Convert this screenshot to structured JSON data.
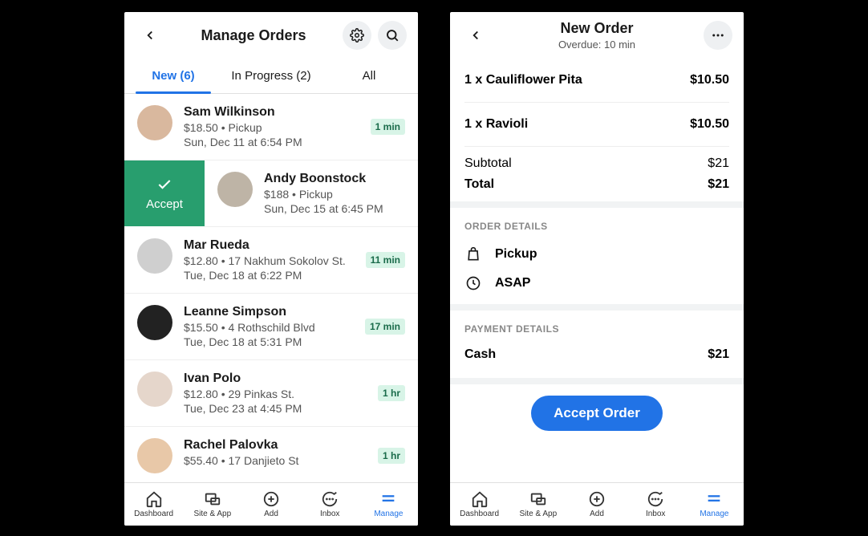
{
  "left": {
    "title": "Manage Orders",
    "tabs": [
      {
        "label": "New (6)",
        "active": true
      },
      {
        "label": "In Progress (2)",
        "active": false
      },
      {
        "label": "All",
        "active": false
      }
    ],
    "accept_label": "Accept",
    "orders": [
      {
        "name": "Sam Wilkinson",
        "meta": "$18.50  •  Pickup",
        "date": "Sun, Dec 11 at 6:54 PM",
        "badge": "1 min",
        "shifted": false,
        "avatar": "#d9b89e"
      },
      {
        "name": "Andy Boonstock",
        "meta": "$188  •  Pickup",
        "date": "Sun, Dec 15 at 6:45 PM",
        "badge": "",
        "shifted": true,
        "avatar": "#beb4a6"
      },
      {
        "name": "Mar Rueda",
        "meta": "$12.80  •  17 Nakhum Sokolov St.",
        "date": "Tue, Dec 18 at 6:22 PM",
        "badge": "11 min",
        "shifted": false,
        "avatar": "#cfcfcf"
      },
      {
        "name": "Leanne Simpson",
        "meta": "$15.50  •  4 Rothschild Blvd",
        "date": "Tue, Dec 18 at 5:31 PM",
        "badge": "17 min",
        "shifted": false,
        "avatar": "#222"
      },
      {
        "name": "Ivan Polo",
        "meta": "$12.80  •  29 Pinkas St.",
        "date": "Tue, Dec 23 at 4:45 PM",
        "badge": "1 hr",
        "shifted": false,
        "avatar": "#e5d6cb"
      },
      {
        "name": "Rachel Palovka",
        "meta": "$55.40  •  17 Danjieto St",
        "date": "",
        "badge": "1 hr",
        "shifted": false,
        "avatar": "#e8c8a8"
      }
    ]
  },
  "right": {
    "title": "New Order",
    "subtitle": "Overdue: 10 min",
    "items": [
      {
        "label": "1 x Cauliflower Pita",
        "price": "$10.50"
      },
      {
        "label": "1 x Ravioli",
        "price": "$10.50"
      }
    ],
    "subtotal_label": "Subtotal",
    "subtotal_price": "$21",
    "total_label": "Total",
    "total_price": "$21",
    "order_details_h": "ORDER DETAILS",
    "fulfillment": "Pickup",
    "timing": "ASAP",
    "payment_details_h": "PAYMENT DETAILS",
    "payment_method": "Cash",
    "payment_amount": "$21",
    "accept_btn": "Accept Order"
  },
  "bottom_tabs": [
    {
      "label": "Dashboard"
    },
    {
      "label": "Site & App"
    },
    {
      "label": "Add"
    },
    {
      "label": "Inbox"
    },
    {
      "label": "Manage"
    }
  ]
}
